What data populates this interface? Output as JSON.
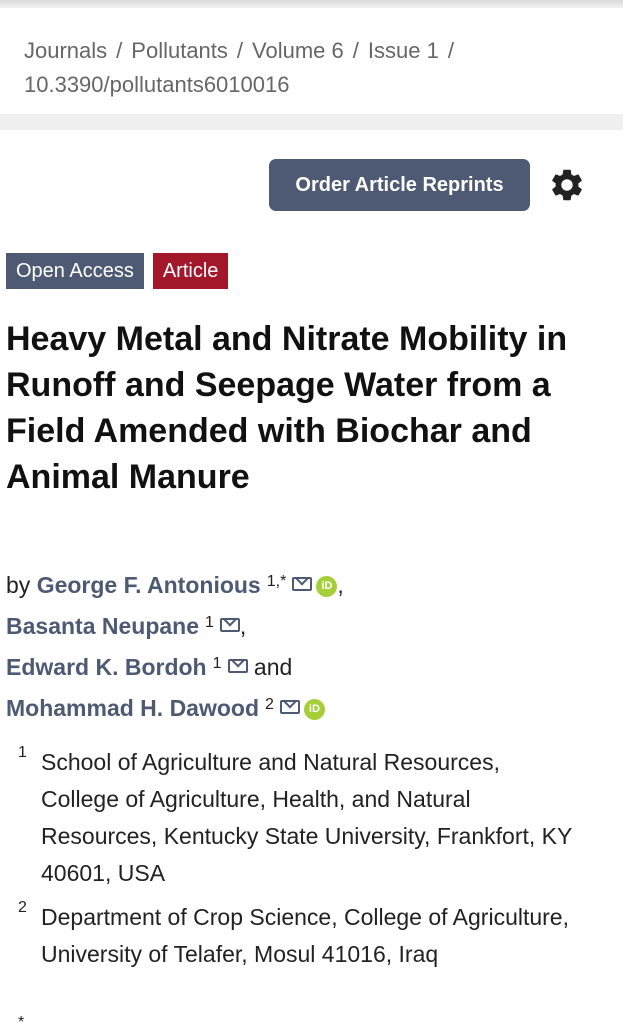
{
  "breadcrumb": {
    "items": [
      "Journals",
      "Pollutants",
      "Volume 6",
      "Issue 1"
    ],
    "separator": "/",
    "doi": "10.3390/pollutants6010016"
  },
  "toolbar": {
    "reprints_label": "Order Article Reprints",
    "settings_icon": "gear-icon"
  },
  "badges": {
    "open_access": "Open Access",
    "article": "Article"
  },
  "article": {
    "title": "Heavy Metal and Nitrate Mobility in Runoff and Seepage Water from a Field Amended with Biochar and Animal Manure"
  },
  "authors": {
    "by": "by",
    "and": "and",
    "list": [
      {
        "name": "George F. Antonious",
        "sup": "1,*",
        "email_icon": "mail-icon",
        "orcid_icon": "orcid-icon",
        "orcid_text": "iD"
      },
      {
        "name": "Basanta Neupane",
        "sup": "1",
        "email_icon": "mail-icon"
      },
      {
        "name": "Edward K. Bordoh",
        "sup": "1",
        "email_icon": "mail-icon"
      },
      {
        "name": "Mohammad H. Dawood",
        "sup": "2",
        "email_icon": "mail-icon",
        "orcid_icon": "orcid-icon",
        "orcid_text": "iD"
      }
    ]
  },
  "affiliations": [
    {
      "num": "1",
      "text": "School of Agriculture and Natural Resources, College of Agriculture, Health, and Natural Resources, Kentucky State University, Frankfort, KY 40601, USA"
    },
    {
      "num": "2",
      "text": "Department of Crop Science, College of Agriculture, University of Telafer, Mosul 41016, Iraq"
    }
  ],
  "footnote_marker": "*",
  "colors": {
    "accent": "#4e5a73",
    "article_badge": "#a3172a",
    "orcid": "#a6ce39"
  }
}
